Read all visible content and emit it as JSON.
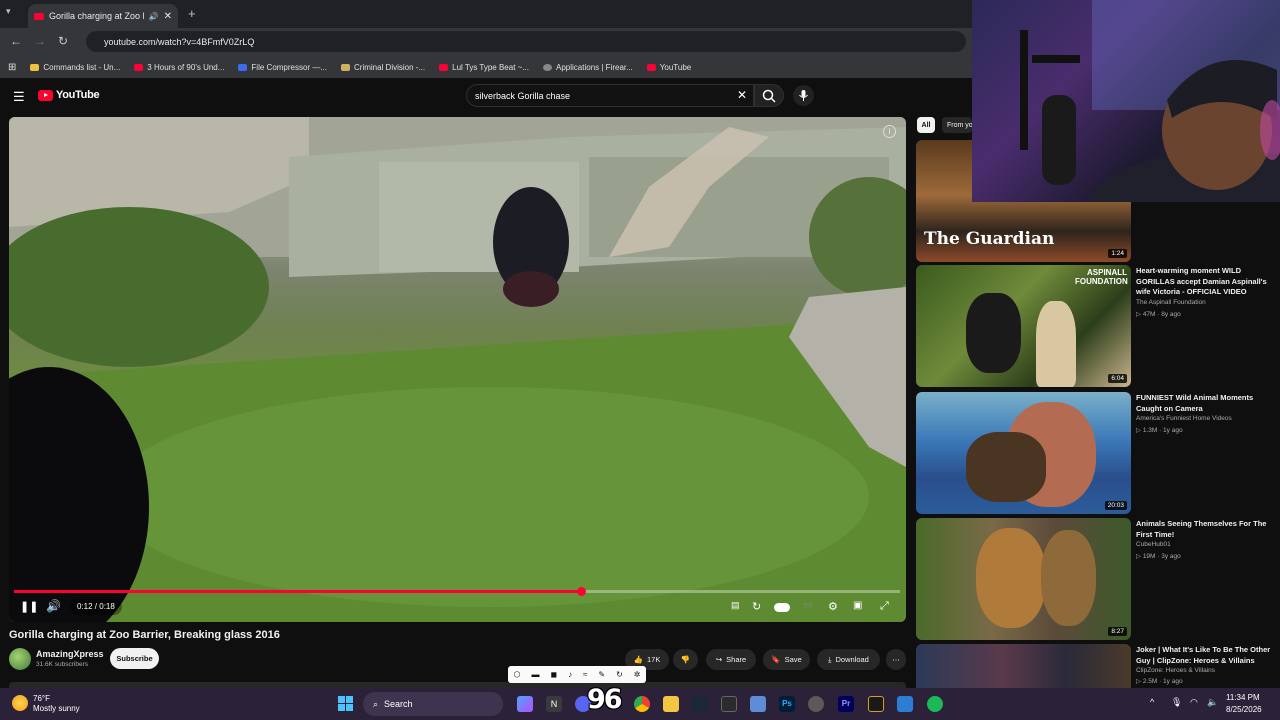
{
  "browser": {
    "tab_title": "Gorilla charging at Zoo Barrier",
    "url": "youtube.com/watch?v=4BFmfV0ZrLQ",
    "bookmarks": [
      {
        "label": "Commands list - Un...",
        "color": "#f0c040"
      },
      {
        "label": "3 Hours of 90's Und...",
        "color": "#ff0033"
      },
      {
        "label": "File Compressor —...",
        "color": "#3b6df0"
      },
      {
        "label": "Criminal Division -...",
        "color": "#d0b060"
      },
      {
        "label": "Lul Tys Type Beat ~...",
        "color": "#ff0033"
      },
      {
        "label": "Applications | Firear...",
        "color": "#888888"
      },
      {
        "label": "YouTube",
        "color": "#ff0033"
      }
    ]
  },
  "youtube": {
    "logo": "YouTube",
    "search_query": "silverback Gorilla chase"
  },
  "player": {
    "time": "0:12 / 0:18",
    "progress": 0.64
  },
  "video": {
    "title": "Gorilla charging at Zoo Barrier, Breaking glass 2016",
    "channel": "AmazingXpress",
    "subscribers": "31.6K subscribers",
    "subscribe_label": "Subscribe",
    "likes": "17K",
    "share_label": "Share",
    "save_label": "Save",
    "download_label": "Download"
  },
  "sidebar": {
    "chips": [
      "All",
      "From yo"
    ],
    "items": [
      {
        "title": "",
        "channel": "",
        "meta": "",
        "duration": "1:24",
        "overlay_text": "The Guardian"
      },
      {
        "title": "Heart-warming moment WILD GORILLAS accept Damian Aspinall's wife Victoria - OFFICIAL VIDEO",
        "channel": "The Aspinall Foundation",
        "meta": "47M · 8y ago",
        "duration": "6:04",
        "overlay_text": "ASPINALL FOUNDATION"
      },
      {
        "title": "FUNNIEST Wild Animal Moments Caught on Camera",
        "channel": "America's Funniest Home Videos",
        "meta": "1.3M · 1y ago",
        "duration": "20:03"
      },
      {
        "title": "Animals Seeing Themselves For The First Time!",
        "channel": "CubeHub01",
        "meta": "19M · 3y ago",
        "duration": "8:27"
      },
      {
        "title": "Joker | What It's Like To Be The Other Guy | ClipZone: Heroes & Villains",
        "channel": "ClipZone: Heroes & Villains",
        "meta": "2.5M · 1y ago",
        "duration": ""
      }
    ]
  },
  "taskbar": {
    "temperature": "76°F",
    "weather": "Mostly sunny",
    "search_label": "Search",
    "time": "11:34 PM",
    "date": "8/25/2026",
    "counter": "96"
  }
}
